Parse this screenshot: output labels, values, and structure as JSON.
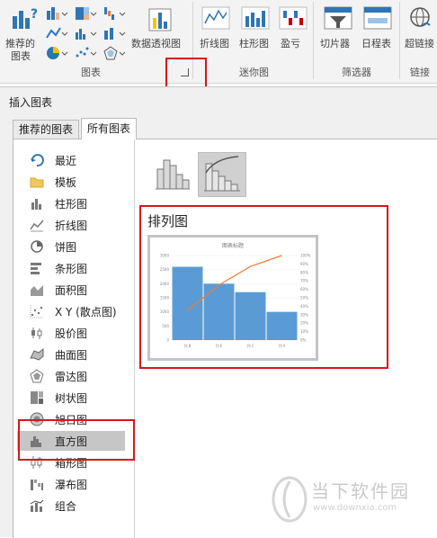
{
  "ribbon": {
    "recommended_label_line1": "推荐的",
    "recommended_label_line2": "图表",
    "pivot_chart_label": "数据透视图",
    "line_label": "折线图",
    "column_label": "柱形图",
    "winloss_label": "盈亏",
    "slicer_label": "切片器",
    "timeline_label": "日程表",
    "hyperlink_label": "超链接",
    "group_charts": "图表",
    "group_sparklines": "迷你图",
    "group_filters": "筛选器",
    "group_links": "链接"
  },
  "dialog": {
    "title": "插入图表",
    "tabs": [
      "推荐的图表",
      "所有图表"
    ],
    "active_tab": "所有图表",
    "sidebar": [
      {
        "label": "最近",
        "icon": "recent-icon"
      },
      {
        "label": "模板",
        "icon": "folder-icon"
      },
      {
        "label": "柱形图",
        "icon": "column-chart-icon"
      },
      {
        "label": "折线图",
        "icon": "line-chart-icon"
      },
      {
        "label": "饼图",
        "icon": "pie-chart-icon"
      },
      {
        "label": "条形图",
        "icon": "bar-chart-icon"
      },
      {
        "label": "面积图",
        "icon": "area-chart-icon"
      },
      {
        "label": "X Y (散点图)",
        "icon": "scatter-chart-icon"
      },
      {
        "label": "股价图",
        "icon": "stock-chart-icon"
      },
      {
        "label": "曲面图",
        "icon": "surface-chart-icon"
      },
      {
        "label": "雷达图",
        "icon": "radar-chart-icon"
      },
      {
        "label": "树状图",
        "icon": "treemap-chart-icon"
      },
      {
        "label": "旭日图",
        "icon": "sunburst-chart-icon"
      },
      {
        "label": "直方图",
        "icon": "histogram-chart-icon"
      },
      {
        "label": "箱形图",
        "icon": "box-whisker-chart-icon"
      },
      {
        "label": "瀑布图",
        "icon": "waterfall-chart-icon"
      },
      {
        "label": "组合",
        "icon": "combo-chart-icon"
      }
    ],
    "selected_category": "直方图",
    "chart_type_name": "排列图",
    "preview": {
      "title": "图表标题",
      "categories": [
        "列 B",
        "列 E",
        "列 C",
        "列 A"
      ],
      "values": [
        2600,
        2000,
        1700,
        1000
      ],
      "cumulative_pct": [
        35,
        65,
        87,
        100
      ],
      "y_ticks": [
        "3000",
        "2500",
        "2000",
        "1500",
        "1000",
        "500",
        "0"
      ],
      "y2_ticks": [
        "100%",
        "90%",
        "80%",
        "70%",
        "60%",
        "50%",
        "40%",
        "30%",
        "20%",
        "10%",
        "0%"
      ],
      "y_max": 3000,
      "bar_color": "#5b9bd5",
      "line_color": "#ed7d31"
    }
  },
  "watermark": {
    "name": "当下软件园",
    "url": "www.downxia.com"
  },
  "colors": {
    "highlight": "#d6161b",
    "selected_bg": "#c6c6c6"
  }
}
